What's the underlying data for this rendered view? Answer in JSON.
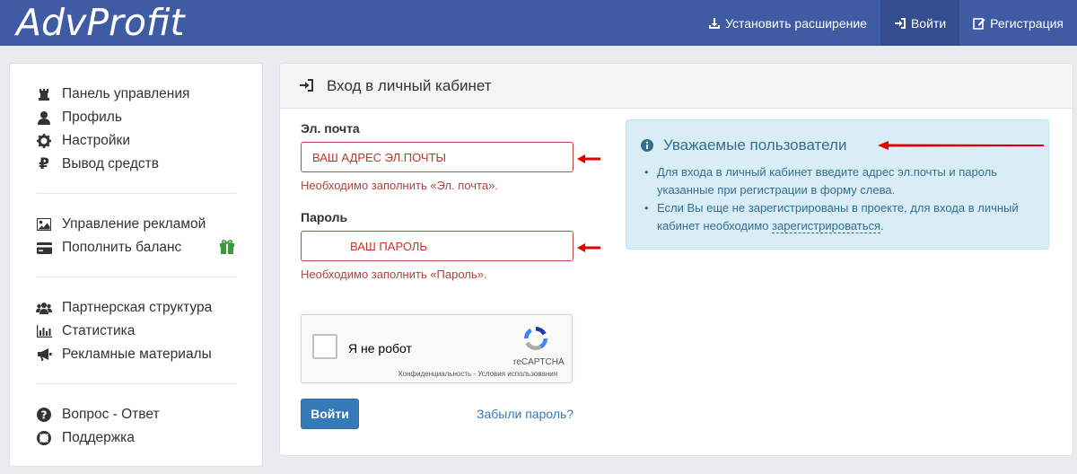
{
  "header": {
    "logo": "AdvProfit",
    "nav": [
      {
        "label": "Установить расширение",
        "icon": "download-icon"
      },
      {
        "label": "Войти",
        "icon": "sign-in-icon"
      },
      {
        "label": "Регистрация",
        "icon": "edit-icon"
      }
    ]
  },
  "sidebar": {
    "items": [
      {
        "label": "Панель управления",
        "icon": "dashboard-icon"
      },
      {
        "label": "Профиль",
        "icon": "user-icon"
      },
      {
        "label": "Настройки",
        "icon": "gear-icon"
      },
      {
        "label": "Вывод средств",
        "icon": "ruble-icon"
      },
      {
        "label": "Управление рекламой",
        "icon": "image-icon"
      },
      {
        "label": "Пополнить баланс",
        "icon": "credit-card-icon"
      },
      {
        "label": "Партнерская структура",
        "icon": "users-icon"
      },
      {
        "label": "Статистика",
        "icon": "bar-chart-icon"
      },
      {
        "label": "Рекламные материалы",
        "icon": "bullhorn-icon"
      },
      {
        "label": "Вопрос - Ответ",
        "icon": "question-icon"
      },
      {
        "label": "Поддержка",
        "icon": "lifebuoy-icon"
      }
    ],
    "gift_icon": "gift-icon"
  },
  "panel": {
    "title": "Вход в личный кабинет",
    "email": {
      "label": "Эл. почта",
      "value": "ВАШ  АДРЕС ЭЛ.ПОЧТЫ",
      "error": "Необходимо заполнить «Эл. почта»."
    },
    "password": {
      "label": "Пароль",
      "value": "ВАШ ПАРОЛЬ",
      "error": "Необходимо заполнить «Пароль»."
    },
    "captcha": {
      "label": "Я не робот",
      "brand": "reCAPTCHA",
      "links": "Конфиденциальность - Условия использования"
    },
    "login_button": "Войти",
    "forgot_link": "Забыли пароль?"
  },
  "info": {
    "title": "Уважаемые пользователи",
    "line1": "Для входа в личный кабинет введите адрес эл.почты и пароль указанные при регистрации в форму слева.",
    "line2_prefix": "Если Вы еще не зарегистрированы в проекте, для входа в личный кабинет необходимо ",
    "line2_link": "зарегистрироваться",
    "line2_suffix": "."
  },
  "colors": {
    "header_bg": "#3f5ba4",
    "accent": "#337ab7",
    "error": "#a94442",
    "annotation_arrow": "#e00000",
    "info_bg": "#d9edf7"
  }
}
